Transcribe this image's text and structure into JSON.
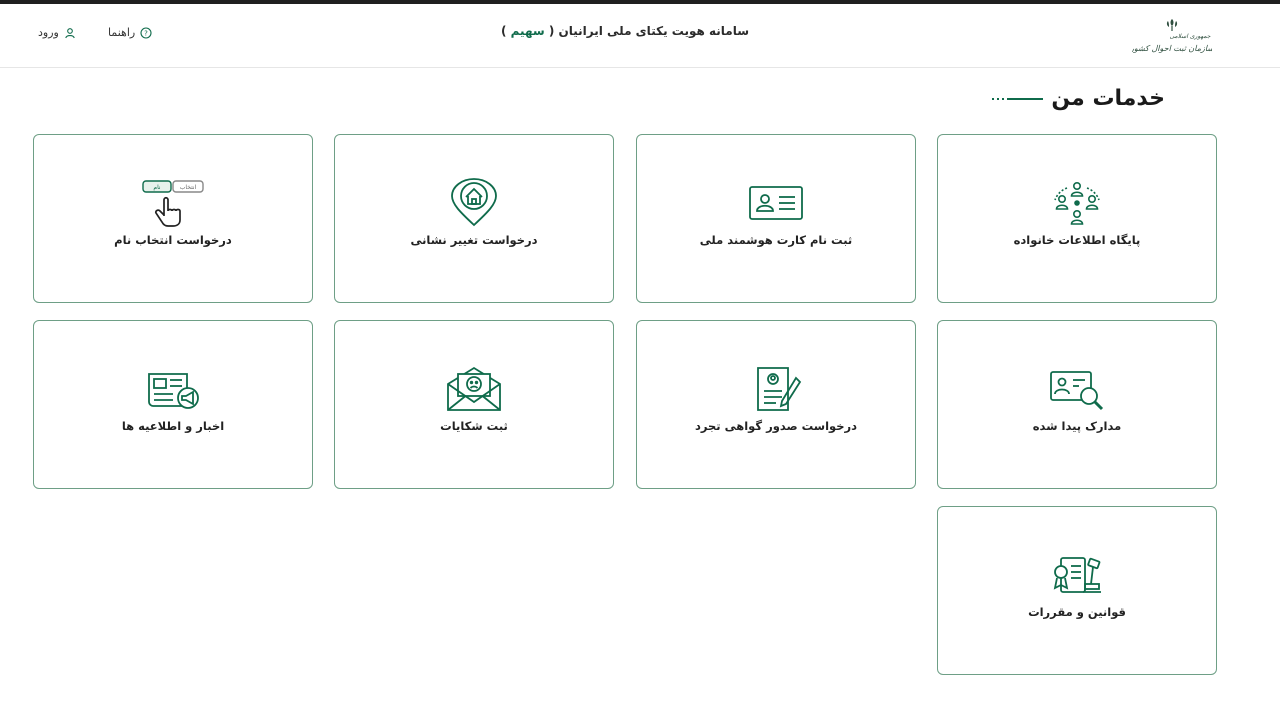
{
  "header": {
    "title_prefix": "سامانه هویت یکتای ملی ایرانیان ( ",
    "title_brand": "سهیم",
    "title_suffix": " )",
    "help_label": "راهنما",
    "login_label": "ورود",
    "logo_text": "سازمان ثبت احوال کشور"
  },
  "section": {
    "title": "خدمات من"
  },
  "services": [
    {
      "label": "پایگاه اطلاعات خانواده",
      "icon": "family-network-icon"
    },
    {
      "label": "ثبت نام کارت هوشمند ملی",
      "icon": "id-card-icon"
    },
    {
      "label": "درخواست تغییر نشانی",
      "icon": "home-location-icon"
    },
    {
      "label": "درخواست انتخاب نام",
      "icon": "select-name-icon",
      "chip_name": "نام",
      "chip_select": "انتخاب"
    },
    {
      "label": "مدارک پیدا شده",
      "icon": "document-search-icon"
    },
    {
      "label": "درخواست صدور گواهی تجرد",
      "icon": "certificate-pen-icon"
    },
    {
      "label": "ثبت شکایات",
      "icon": "complaint-envelope-icon"
    },
    {
      "label": "اخبار و اطلاعیه ها",
      "icon": "news-megaphone-icon"
    },
    {
      "label": "قوانین و مقررات",
      "icon": "law-gavel-icon"
    }
  ],
  "colors": {
    "accent": "#0f6b4b",
    "card_border": "#6e9f86"
  }
}
